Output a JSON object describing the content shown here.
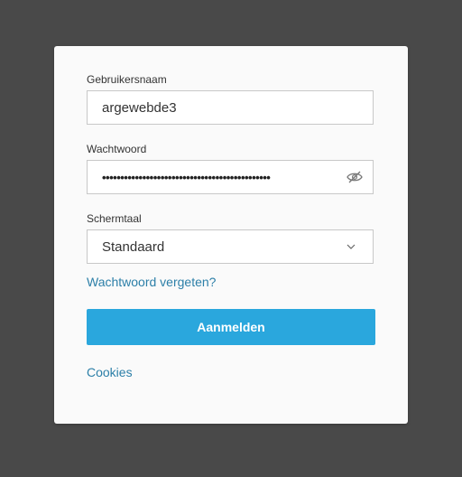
{
  "login": {
    "username_label": "Gebruikersnaam",
    "username_value": "argewebde3",
    "password_label": "Wachtwoord",
    "password_masked": "••••••••••••••••••••••••••••••••••••••••••••••",
    "language_label": "Schermtaal",
    "language_selected": "Standaard",
    "forgot_password": "Wachtwoord vergeten?",
    "submit_label": "Aanmelden",
    "cookies_link": "Cookies"
  },
  "icons": {
    "password_toggle": "eye-slash-icon",
    "language_dropdown": "chevron-down-icon"
  },
  "colors": {
    "background": "#494949",
    "panel": "#fafafa",
    "accent": "#2aa7dd",
    "link": "#2c7fa8"
  }
}
